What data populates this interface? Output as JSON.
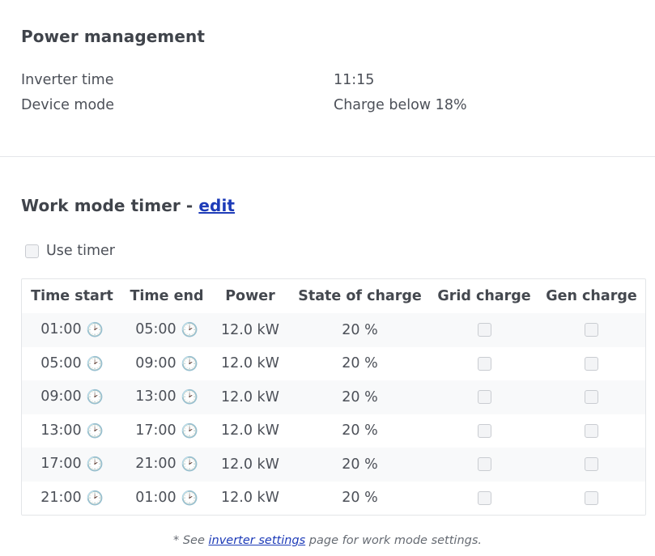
{
  "power_management": {
    "title": "Power management",
    "rows": [
      {
        "label": "Inverter time",
        "value": "11:15"
      },
      {
        "label": "Device mode",
        "value": "Charge below 18%"
      }
    ]
  },
  "work_mode_timer": {
    "title": "Work mode timer - ",
    "edit_link": "edit",
    "use_timer_label": "Use timer",
    "use_timer_checked": false,
    "columns": [
      "Time start",
      "Time end",
      "Power",
      "State of charge",
      "Grid charge",
      "Gen charge"
    ],
    "rows": [
      {
        "start": "01:00",
        "end": "05:00",
        "power": "12.0 kW",
        "soc": "20 %",
        "grid_charge": false,
        "gen_charge": false
      },
      {
        "start": "05:00",
        "end": "09:00",
        "power": "12.0 kW",
        "soc": "20 %",
        "grid_charge": false,
        "gen_charge": false
      },
      {
        "start": "09:00",
        "end": "13:00",
        "power": "12.0 kW",
        "soc": "20 %",
        "grid_charge": false,
        "gen_charge": false
      },
      {
        "start": "13:00",
        "end": "17:00",
        "power": "12.0 kW",
        "soc": "20 %",
        "grid_charge": false,
        "gen_charge": false
      },
      {
        "start": "17:00",
        "end": "21:00",
        "power": "12.0 kW",
        "soc": "20 %",
        "grid_charge": false,
        "gen_charge": false
      },
      {
        "start": "21:00",
        "end": "01:00",
        "power": "12.0 kW",
        "soc": "20 %",
        "grid_charge": false,
        "gen_charge": false
      }
    ],
    "clock_icon": "clock-icon"
  },
  "footnote": {
    "prefix": "* See ",
    "link": "inverter settings",
    "suffix": " page for work mode settings."
  },
  "colors": {
    "link": "#1d3bb8",
    "text": "#4c5058",
    "stripe": "#f8f9fa"
  }
}
